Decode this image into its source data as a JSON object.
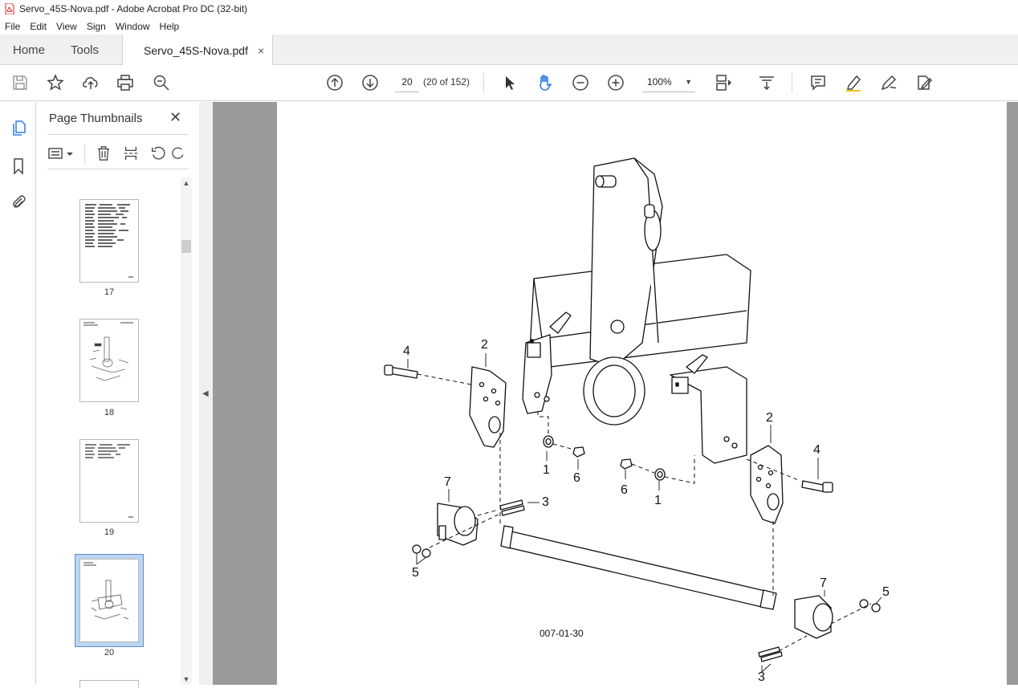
{
  "window": {
    "title": "Servo_45S-Nova.pdf - Adobe Acrobat Pro DC (32-bit)"
  },
  "menu": [
    "File",
    "Edit",
    "View",
    "Sign",
    "Window",
    "Help"
  ],
  "tabs": {
    "home": "Home",
    "tools": "Tools",
    "document": "Servo_45S-Nova.pdf",
    "close_glyph": "×"
  },
  "toolbar": {
    "page_number": "20",
    "page_count": "(20 of 152)",
    "zoom": "100%",
    "icons": [
      "save-icon",
      "star-icon",
      "upload-icon",
      "print-icon",
      "find-icon",
      "prev-page-icon",
      "next-page-icon",
      "select-icon",
      "hand-icon",
      "zoom-out-icon",
      "zoom-in-icon",
      "page-layout-icon",
      "scroll-mode-icon",
      "comment-icon",
      "highlight-icon",
      "draw-icon",
      "fill-sign-icon"
    ]
  },
  "left_rail": {
    "icons": [
      "pages-icon",
      "bookmark-icon",
      "attachment-icon"
    ]
  },
  "panel": {
    "title": "Page Thumbnails",
    "close_glyph": "✕",
    "thumbnails": [
      {
        "label": "17"
      },
      {
        "label": "18"
      },
      {
        "label": "19"
      },
      {
        "label": "20",
        "selected": true
      }
    ]
  },
  "document": {
    "figure_id": "007-01-30",
    "callouts": [
      "4",
      "2",
      "1",
      "6",
      "6",
      "1",
      "2",
      "4",
      "7",
      "3",
      "5",
      "7",
      "5",
      "3"
    ]
  },
  "colors": {
    "accent": "#2d7be5",
    "viewer_bg": "#9a9a9a",
    "selected_thumb": "#bcd5f0"
  }
}
